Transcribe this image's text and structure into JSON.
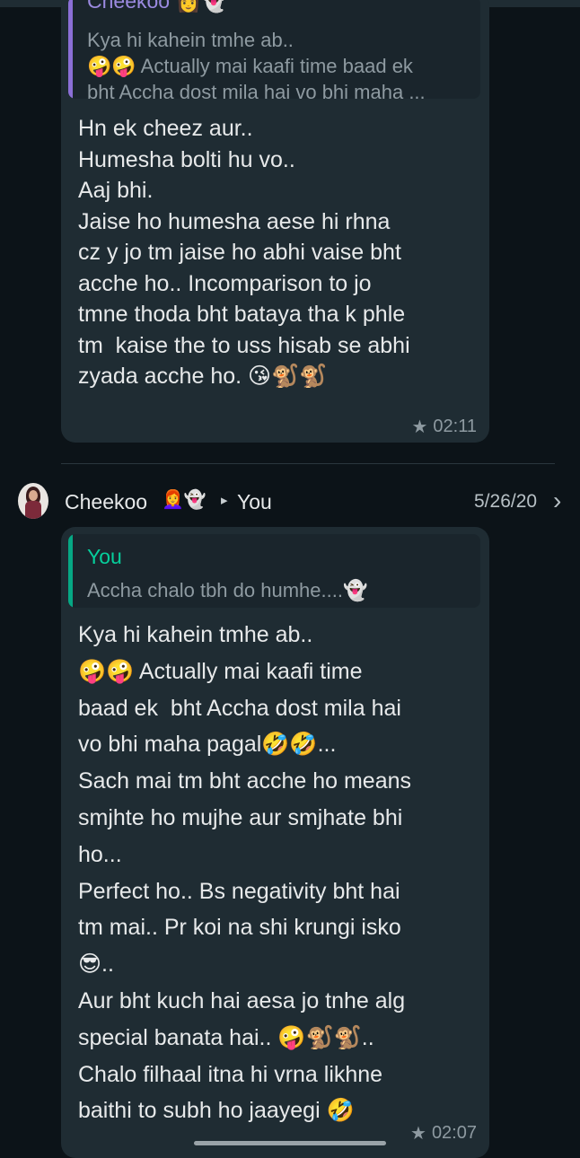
{
  "message1": {
    "quote_author": "Cheekoo 👩‍👻",
    "quote_text_line1": "Kya hi kahein tmhe ab..",
    "quote_text_line2": "🤪🤪 Actually mai kaafi time baad ek",
    "quote_text_line3": "bht Accha dost mila hai vo bhi maha ...",
    "text": "Hn ek cheez aur..\nHumesha bolti hu vo..\nAaj bhi.\nJaise ho humesha aese hi rhna\ncz y jo tm jaise ho abhi vaise bht\nacche ho.. Incomparison to jo\ntmne thoda bht bataya tha k phle\ntm  kaise the to uss hisab se abhi\nzyada acche ho. 😘🐒🐒",
    "time": "02:11"
  },
  "sender_row": {
    "name": "Cheekoo",
    "name_emoji": "👩‍🦰👻",
    "arrow": "▸",
    "recipient": "You",
    "date": "5/26/20",
    "chevron": "›"
  },
  "message2": {
    "quote_author": "You",
    "quote_text": "Accha chalo tbh do humhe....👻",
    "text": "Kya hi kahein tmhe ab..\n🤪🤪 Actually mai kaafi time\nbaad ek  bht Accha dost mila hai\nvo bhi maha pagal🤣🤣...\nSach mai tm bht acche ho means\nsmjhte ho mujhe aur smjhate bhi\nho...\nPerfect ho.. Bs negativity bht hai\ntm mai.. Pr koi na shi krungi isko\n😎..\nAur bht kuch hai aesa jo tnhe alg\nspecial banata hai.. 🤪🐒🐒..\nChalo filhaal itna hi vrna likhne\nbaithi to subh ho jaayegi 🤣",
    "time": "02:07"
  },
  "icons": {
    "star": "★"
  },
  "colors": {
    "background": "#0c1318",
    "bubble": "#1f2c33",
    "quote_bar_1": "#8b6fd6",
    "quote_bar_2": "#06a884",
    "quote_author_1": "#9b8ae0",
    "quote_author_2": "#06cf9c"
  }
}
